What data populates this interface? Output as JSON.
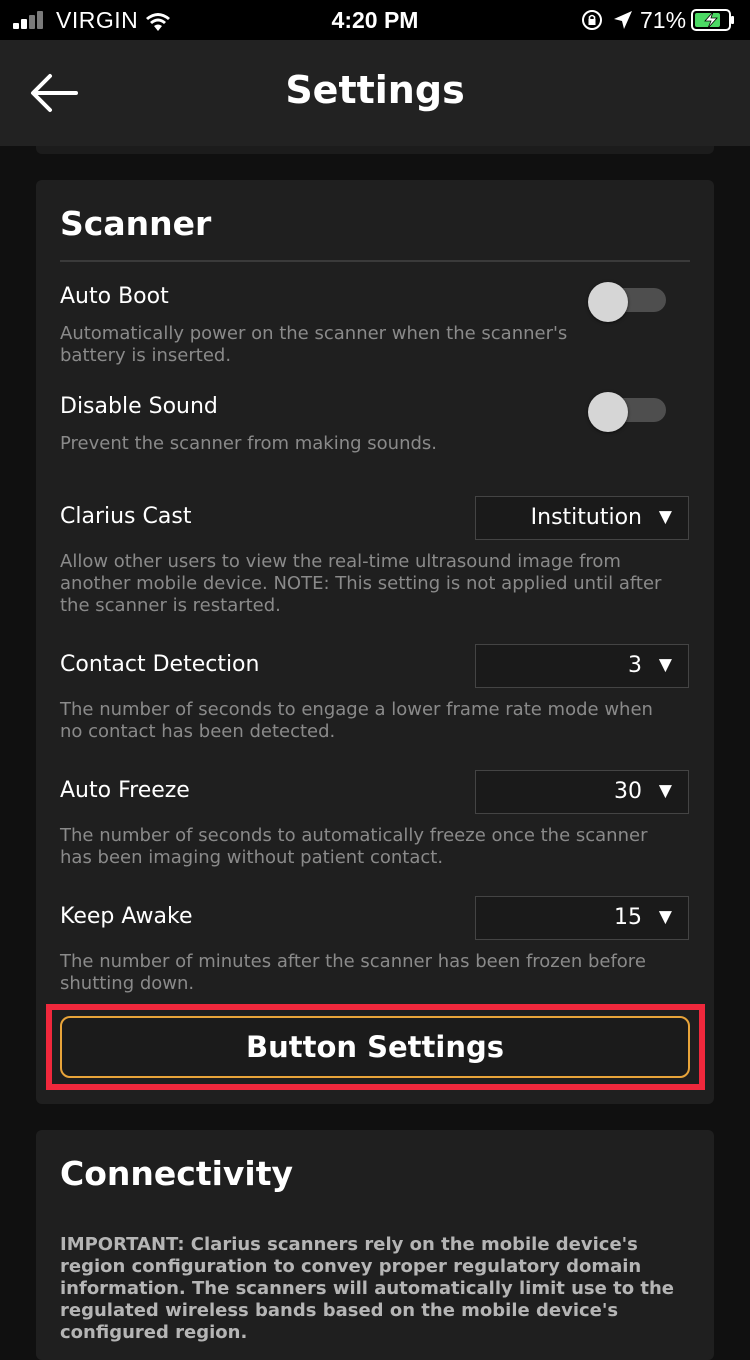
{
  "status_bar": {
    "carrier": "VIRGIN",
    "time": "4:20 PM",
    "battery_percent": "71%"
  },
  "header": {
    "title": "Settings"
  },
  "scanner": {
    "title": "Scanner",
    "auto_boot": {
      "label": "Auto Boot",
      "description": "Automatically power on the scanner when the scanner's battery is inserted.",
      "enabled": false
    },
    "disable_sound": {
      "label": "Disable Sound",
      "description": "Prevent the scanner from making sounds.",
      "enabled": false
    },
    "clarius_cast": {
      "label": "Clarius Cast",
      "value": "Institution",
      "description": "Allow other users to view the real-time ultrasound image from another mobile device. NOTE: This setting is not applied until after the scanner is restarted."
    },
    "contact_detection": {
      "label": "Contact Detection",
      "value": "3",
      "description": "The number of seconds to engage a lower frame rate mode when no contact has been detected."
    },
    "auto_freeze": {
      "label": "Auto Freeze",
      "value": "30",
      "description": "The number of seconds to automatically freeze once the scanner has been imaging without patient contact."
    },
    "keep_awake": {
      "label": "Keep Awake",
      "value": "15",
      "description": "The number of minutes after the scanner has been frozen before shutting down."
    },
    "button_settings_label": "Button Settings"
  },
  "connectivity": {
    "title": "Connectivity",
    "important_text": "IMPORTANT: Clarius scanners rely on the mobile device's region configuration to convey proper regulatory domain information. The scanners will automatically limit use to the regulated wireless bands based on the mobile device's configured region."
  },
  "colors": {
    "highlight_border": "#f0283c",
    "button_border": "#e8a43a",
    "card_bg": "#1f1f1f",
    "description_text": "#8a8a8a"
  }
}
